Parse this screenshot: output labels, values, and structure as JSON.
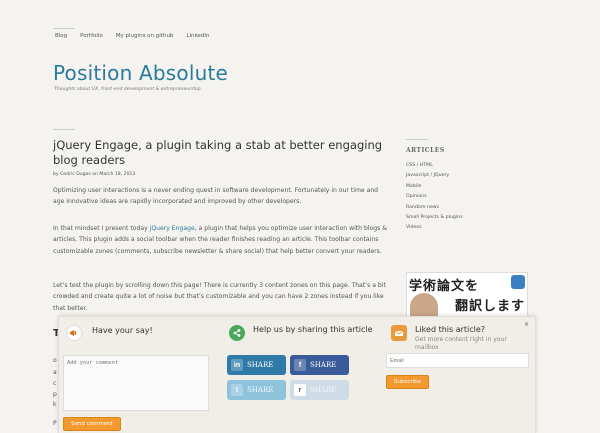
{
  "nav": [
    "Blog",
    "Portfolio",
    "My plugins on github",
    "LinkedIn"
  ],
  "site": {
    "title": "Position Absolute",
    "tagline": "Thoughts about UX, front-end development & entrepreneurship"
  },
  "post": {
    "title": "jQuery Engage, a plugin taking a stab at better engaging blog readers",
    "meta": "by Cedric Dugas on March 18, 2013",
    "p1": "Optimizing user interactions is a never ending quest in software development. Fortunately in our time and age innovative ideas are rapidly incorporated and improved by other developers.",
    "p2_before": "In that mindset I present today ",
    "p2_link": "jQuery Engage",
    "p2_after": ", a plugin that helps you optimize user interaction with blogs & articles. This plugin adds a social toolbar when the reader finishes reading an article. This toolbar contains customizable zones (comments, subscribe newsletter & share social) that help better convert your readers.",
    "p3": "Let’s test the plugin by scrolling down this page! There is currently 3 content zones on this page. That’s a bit crowded and create quite a lot of noise but that’s customizable and you can have 2 zones instead if you like that better.",
    "partial_heading": "T",
    "partial_lines": [
      "o",
      "a",
      "c",
      "p",
      "k"
    ],
    "partial_bottom": "P"
  },
  "sidebar": {
    "heading": "ARTICLES",
    "items": [
      "CSS / HTML",
      "Javascript / JQuery",
      "Mobile",
      "Opinions",
      "Random news",
      "Small Projects & plugins",
      "Videos"
    ],
    "ad_line1": "学術論文を",
    "ad_line2": "翻訳します"
  },
  "engage": {
    "close": "×",
    "comment": {
      "title": "Have your say!",
      "placeholder": "Add your comment",
      "button": "Send comment"
    },
    "share": {
      "title": "Help us by sharing this article",
      "buttons": [
        {
          "label": "SHARE",
          "icon": "in"
        },
        {
          "label": "SHARE",
          "icon": "f"
        },
        {
          "label": "SHARE",
          "icon": "t"
        },
        {
          "label": "SHARE",
          "icon": "r"
        }
      ]
    },
    "subscribe": {
      "title": "Liked this article?",
      "subtitle": "Get more content right in your mailbox",
      "placeholder": "Email",
      "button": "Subscribe"
    }
  },
  "colors": {
    "background": "#f4f3ef",
    "title_blue": "#2b7a9c",
    "orange": "#f29a2e",
    "linkedin": "#2f7aa8",
    "facebook": "#3a5b99",
    "twitter": "#8fc3dc"
  }
}
